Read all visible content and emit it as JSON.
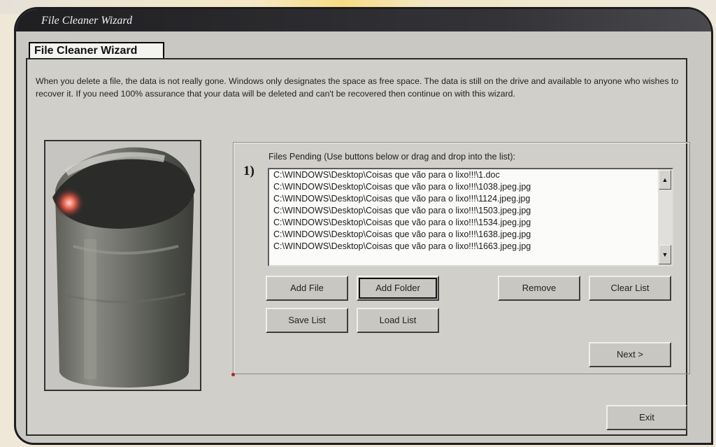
{
  "window": {
    "title": "File Cleaner Wizard"
  },
  "tab": {
    "label": "File Cleaner Wizard"
  },
  "intro_text": "When you delete a file, the data is not really gone. Windows only designates the space as free space. The data is still on the drive and available to anyone who wishes to recover it. If you need 100% assurance that your data will be deleted and can't be recovered then continue on with this wizard.",
  "step": {
    "number": "1)",
    "files_label": "Files Pending (Use buttons below or drag and drop into the list):",
    "files": [
      "C:\\WINDOWS\\Desktop\\Coisas que vão para o lixo!!!\\1.doc",
      "C:\\WINDOWS\\Desktop\\Coisas que vão para o lixo!!!\\1038.jpeg.jpg",
      "C:\\WINDOWS\\Desktop\\Coisas que vão para o lixo!!!\\1124.jpeg.jpg",
      "C:\\WINDOWS\\Desktop\\Coisas que vão para o lixo!!!\\1503.jpeg.jpg",
      "C:\\WINDOWS\\Desktop\\Coisas que vão para o lixo!!!\\1534.jpeg.jpg",
      "C:\\WINDOWS\\Desktop\\Coisas que vão para o lixo!!!\\1638.jpeg.jpg",
      "C:\\WINDOWS\\Desktop\\Coisas que vão para o lixo!!!\\1663.jpeg.jpg"
    ]
  },
  "buttons": {
    "add_file": "Add File",
    "add_folder": "Add Folder",
    "remove": "Remove",
    "clear_list": "Clear List",
    "save_list": "Save List",
    "load_list": "Load List",
    "next": "Next >",
    "exit": "Exit"
  },
  "icons": {
    "scroll_up": "scroll-up-arrow-icon",
    "scroll_down": "scroll-down-arrow-icon"
  }
}
